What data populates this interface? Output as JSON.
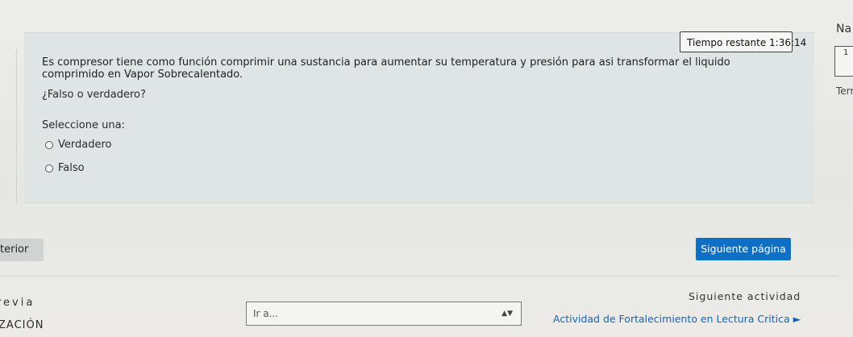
{
  "timer": {
    "label": "Tiempo restante 1:36:14"
  },
  "question": {
    "text": "Es compresor tiene como función comprimir una sustancia para aumentar su temperatura y presión para asi transformar el liquido comprimido en Vapor Sobrecalentado.",
    "prompt": "¿Falso o verdadero?",
    "select_label": "Seleccione una:",
    "options": [
      {
        "label": "Verdadero"
      },
      {
        "label": "Falso"
      }
    ]
  },
  "quiz_nav": {
    "title": "Na",
    "item_number": "1",
    "finish_label": "Terr"
  },
  "page_nav": {
    "prev_label": "terior",
    "next_label": "Siguiente página"
  },
  "activity_nav": {
    "prev_label": "revia",
    "prev_link": "ZACIÓN",
    "jump_placeholder": "Ir a...",
    "jump_arrows": "▲▼",
    "next_label": "Siguiente actividad",
    "next_link": "Actividad de Fortalecimiento en Lectura Critica ►"
  }
}
